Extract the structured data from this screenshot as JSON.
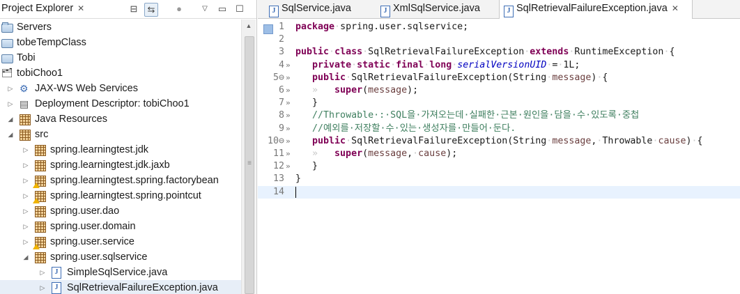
{
  "explorer": {
    "title": "Project Explorer",
    "close_glyph": "✕",
    "toolbar_icons": [
      "collapse-all-icon",
      "link-with-editor-icon",
      "focus-icon",
      "view-menu-icon",
      "minimize-icon",
      "maximize-icon"
    ],
    "tree": [
      {
        "label": "Servers",
        "icon": "folder-open-icon",
        "depth": 0,
        "arrow": ""
      },
      {
        "label": "tobeTempClass",
        "icon": "folder-icon",
        "depth": 0,
        "arrow": ""
      },
      {
        "label": "Tobi",
        "icon": "folder-icon",
        "depth": 0,
        "arrow": ""
      },
      {
        "label": "tobiChoo1",
        "icon": "project-icon",
        "depth": 0,
        "arrow": ""
      },
      {
        "label": "JAX-WS Web Services",
        "icon": "webservices-icon",
        "depth": 1,
        "arrow": "▷"
      },
      {
        "label": "Deployment Descriptor: tobiChoo1",
        "icon": "descriptor-icon",
        "depth": 1,
        "arrow": "▷"
      },
      {
        "label": "Java Resources",
        "icon": "java-resources-icon",
        "depth": 1,
        "arrow": "◢"
      },
      {
        "label": "src",
        "icon": "source-folder-icon",
        "depth": 2,
        "arrow": "◢"
      },
      {
        "label": "spring.learningtest.jdk",
        "icon": "package-icon",
        "depth": 3,
        "arrow": "▷"
      },
      {
        "label": "spring.learningtest.jdk.jaxb",
        "icon": "package-icon",
        "depth": 3,
        "arrow": "▷"
      },
      {
        "label": "spring.learningtest.spring.factorybean",
        "icon": "package-warning-icon",
        "depth": 3,
        "arrow": "▷"
      },
      {
        "label": "spring.learningtest.spring.pointcut",
        "icon": "package-warning-icon",
        "depth": 3,
        "arrow": "▷"
      },
      {
        "label": "spring.user.dao",
        "icon": "package-icon",
        "depth": 3,
        "arrow": "▷"
      },
      {
        "label": "spring.user.domain",
        "icon": "package-icon",
        "depth": 3,
        "arrow": "▷"
      },
      {
        "label": "spring.user.service",
        "icon": "package-warning-icon",
        "depth": 3,
        "arrow": "▷"
      },
      {
        "label": "spring.user.sqlservice",
        "icon": "package-icon",
        "depth": 3,
        "arrow": "◢"
      },
      {
        "label": "SimpleSqlService.java",
        "icon": "java-file-icon",
        "depth": 4,
        "arrow": "▷"
      },
      {
        "label": "SqlRetrievalFailureException.java",
        "icon": "java-file-icon",
        "depth": 4,
        "arrow": "▷",
        "selected": true
      }
    ]
  },
  "editor": {
    "tabs": [
      {
        "label": "SqlService.java",
        "active": false
      },
      {
        "label": "XmlSqlService.java",
        "active": false
      },
      {
        "label": "SqlRetrievalFailureException.java",
        "active": true,
        "close": "✕"
      }
    ],
    "lines": [
      {
        "n": "1",
        "m": "",
        "segs": [
          [
            "kw",
            "package"
          ],
          [
            "ws",
            "·"
          ],
          [
            "tk",
            "spring.user.sqlservice;"
          ]
        ]
      },
      {
        "n": "2",
        "m": "",
        "segs": []
      },
      {
        "n": "3",
        "m": "",
        "segs": [
          [
            "kw",
            "public"
          ],
          [
            "ws",
            "·"
          ],
          [
            "kw",
            "class"
          ],
          [
            "ws",
            "·"
          ],
          [
            "tk",
            "SqlRetrievalFailureException"
          ],
          [
            "ws",
            "·"
          ],
          [
            "kw",
            "extends"
          ],
          [
            "ws",
            "·"
          ],
          [
            "tk",
            "RuntimeException"
          ],
          [
            "ws",
            "·"
          ],
          [
            "tk",
            "{"
          ]
        ]
      },
      {
        "n": "4",
        "m": "»",
        "segs": [
          [
            "ws",
            "   "
          ],
          [
            "kw",
            "private"
          ],
          [
            "ws",
            "·"
          ],
          [
            "kw",
            "static"
          ],
          [
            "ws",
            "·"
          ],
          [
            "kw",
            "final"
          ],
          [
            "ws",
            "·"
          ],
          [
            "kw",
            "long"
          ],
          [
            "ws",
            "·"
          ],
          [
            "fld",
            "serialVersionUID"
          ],
          [
            "ws",
            "·"
          ],
          [
            "tk",
            "="
          ],
          [
            "ws",
            "·"
          ],
          [
            "tk",
            "1L;"
          ]
        ]
      },
      {
        "n": "5⊖",
        "m": "»",
        "segs": [
          [
            "ws",
            "   "
          ],
          [
            "kw",
            "public"
          ],
          [
            "ws",
            "·"
          ],
          [
            "tk",
            "SqlRetrievalFailureException(String"
          ],
          [
            "ws",
            "·"
          ],
          [
            "param",
            "message"
          ],
          [
            "tk",
            ")"
          ],
          [
            "ws",
            "·"
          ],
          [
            "tk",
            "{"
          ]
        ]
      },
      {
        "n": "6",
        "m": "»",
        "segs": [
          [
            "ws",
            "   »   "
          ],
          [
            "kw",
            "super"
          ],
          [
            "tk",
            "("
          ],
          [
            "param",
            "message"
          ],
          [
            "tk",
            ");"
          ]
        ]
      },
      {
        "n": "7",
        "m": "»",
        "segs": [
          [
            "ws",
            "   "
          ],
          [
            "tk",
            "}"
          ]
        ]
      },
      {
        "n": "8",
        "m": "»",
        "segs": [
          [
            "ws",
            "   "
          ],
          [
            "cm",
            "//Throwable·:·SQL을·가져오는데·실패한·근본·원인을·담을·수·있도록·중첩"
          ]
        ]
      },
      {
        "n": "9",
        "m": "»",
        "segs": [
          [
            "ws",
            "   "
          ],
          [
            "cm",
            "//예외를·저장할·수·있는·생성자를·만들어·둔다."
          ]
        ]
      },
      {
        "n": "10⊖",
        "m": "»",
        "segs": [
          [
            "ws",
            "   "
          ],
          [
            "kw",
            "public"
          ],
          [
            "ws",
            "·"
          ],
          [
            "tk",
            "SqlRetrievalFailureException(String"
          ],
          [
            "ws",
            "·"
          ],
          [
            "param",
            "message"
          ],
          [
            "tk",
            ","
          ],
          [
            "ws",
            "·"
          ],
          [
            "tk",
            "Throwable"
          ],
          [
            "ws",
            "·"
          ],
          [
            "param",
            "cause"
          ],
          [
            "tk",
            ")"
          ],
          [
            "ws",
            "·"
          ],
          [
            "tk",
            "{"
          ]
        ]
      },
      {
        "n": "11",
        "m": "»",
        "segs": [
          [
            "ws",
            "   »   "
          ],
          [
            "kw",
            "super"
          ],
          [
            "tk",
            "("
          ],
          [
            "param",
            "message"
          ],
          [
            "tk",
            ","
          ],
          [
            "ws",
            "·"
          ],
          [
            "param",
            "cause"
          ],
          [
            "tk",
            ");"
          ]
        ]
      },
      {
        "n": "12",
        "m": "»",
        "segs": [
          [
            "ws",
            "   "
          ],
          [
            "tk",
            "}"
          ]
        ]
      },
      {
        "n": "13",
        "m": "",
        "segs": [
          [
            "tk",
            "}"
          ]
        ]
      },
      {
        "n": "14",
        "m": "",
        "segs": [],
        "current": true
      }
    ]
  }
}
